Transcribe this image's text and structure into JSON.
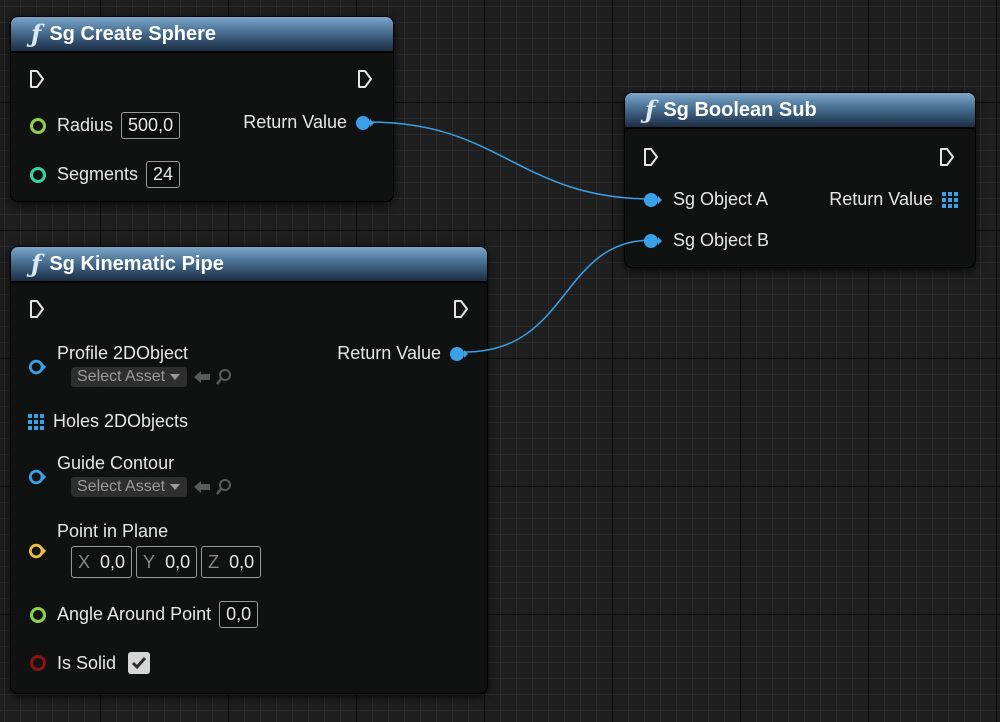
{
  "nodes": {
    "create_sphere": {
      "title": "Sg Create Sphere",
      "inputs": [
        {
          "label": "Radius",
          "value": "500,0"
        },
        {
          "label": "Segments",
          "value": "24"
        }
      ],
      "output_label": "Return Value"
    },
    "kinematic_pipe": {
      "title": "Sg Kinematic Pipe",
      "profile_label": "Profile 2DObject",
      "profile_select": "Select Asset",
      "holes_label": "Holes 2DObjects",
      "guide_label": "Guide Contour",
      "guide_select": "Select Asset",
      "point_label": "Point in Plane",
      "point": {
        "x_axis": "X",
        "x": "0,0",
        "y_axis": "Y",
        "y": "0,0",
        "z_axis": "Z",
        "z": "0,0"
      },
      "angle_label": "Angle Around Point",
      "angle_value": "0,0",
      "solid_label": "Is Solid",
      "solid_checked": true,
      "output_label": "Return Value"
    },
    "boolean_sub": {
      "title": "Sg Boolean Sub",
      "input_a": "Sg Object A",
      "input_b": "Sg Object B",
      "output_label": "Return Value"
    }
  },
  "icons": {
    "function": "function-icon",
    "exec": "exec-pin-icon",
    "object_pin": "object-pin-icon",
    "array_pin": "array-pin-icon"
  },
  "colors": {
    "header": "#4d7497",
    "float_pin": "#8fd14f",
    "int_pin": "#3ad3a0",
    "object_pin": "#3aa0e8",
    "vector_pin": "#e8c23a",
    "bool_pin": "#8a1414",
    "wire": "#3aa0e8"
  }
}
